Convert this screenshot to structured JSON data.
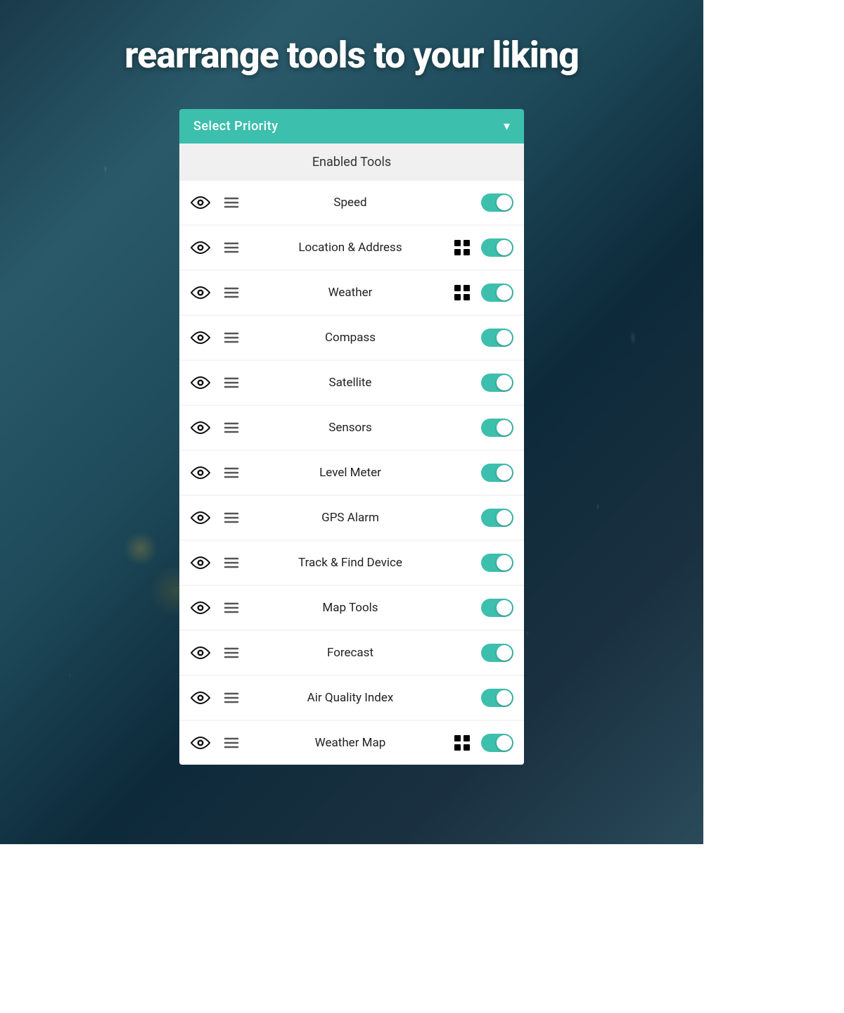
{
  "background": {
    "description": "Rainy window background with blurred city lights"
  },
  "header": {
    "title": "rearrange tools to your liking",
    "title_color": "#ffffff"
  },
  "priority_bar": {
    "label": "Select Priority",
    "chevron": "▾"
  },
  "enabled_tools_section": {
    "heading": "Enabled Tools"
  },
  "tools": [
    {
      "id": "speed",
      "label": "Speed",
      "has_widget": false,
      "enabled": true
    },
    {
      "id": "location",
      "label": "Location & Address",
      "has_widget": true,
      "enabled": true
    },
    {
      "id": "weather",
      "label": "Weather",
      "has_widget": true,
      "enabled": true
    },
    {
      "id": "compass",
      "label": "Compass",
      "has_widget": false,
      "enabled": true
    },
    {
      "id": "satellite",
      "label": "Satellite",
      "has_widget": false,
      "enabled": true
    },
    {
      "id": "sensors",
      "label": "Sensors",
      "has_widget": false,
      "enabled": true
    },
    {
      "id": "level-meter",
      "label": "Level Meter",
      "has_widget": false,
      "enabled": true
    },
    {
      "id": "gps-alarm",
      "label": "GPS Alarm",
      "has_widget": false,
      "enabled": true
    },
    {
      "id": "track-device",
      "label": "Track & Find Device",
      "has_widget": false,
      "enabled": true
    },
    {
      "id": "map-tools",
      "label": "Map Tools",
      "has_widget": false,
      "enabled": true
    },
    {
      "id": "forecast",
      "label": "Forecast",
      "has_widget": false,
      "enabled": true
    },
    {
      "id": "air-quality",
      "label": "Air Quality Index",
      "has_widget": false,
      "enabled": true
    },
    {
      "id": "weather-map",
      "label": "Weather Map",
      "has_widget": true,
      "enabled": true
    }
  ],
  "colors": {
    "teal": "#3dbfad",
    "toggle_on": "#3dbfad",
    "toggle_off": "#cccccc",
    "white": "#ffffff",
    "text_dark": "#222222"
  }
}
